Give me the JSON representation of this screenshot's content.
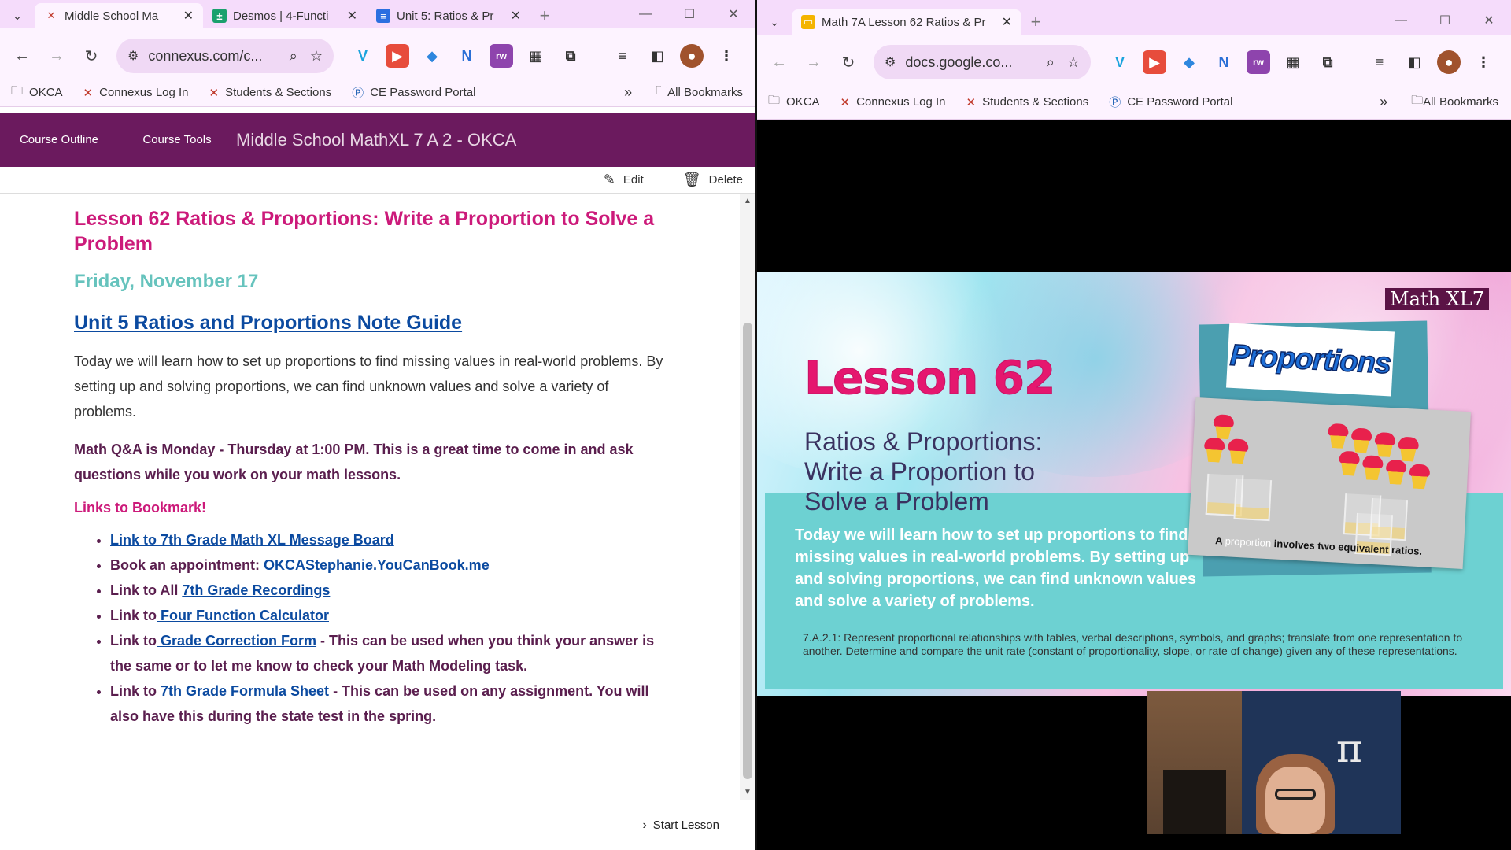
{
  "left_window": {
    "tabs": [
      {
        "title": "Middle School Ma",
        "favicon": "connexus-x-icon",
        "active": true
      },
      {
        "title": "Desmos | 4-Functi",
        "favicon": "desmos-icon",
        "active": false
      },
      {
        "title": "Unit 5: Ratios & Pr",
        "favicon": "docs-icon",
        "active": false
      }
    ],
    "url": "connexus.com/c...",
    "bookmarks": [
      "OKCA",
      "Connexus Log In",
      "Students & Sections",
      "CE Password Portal"
    ],
    "all_bookmarks": "All Bookmarks",
    "course_nav": {
      "outline": "Course Outline",
      "tools": "Course Tools",
      "title": "Middle School MathXL 7 A 2 - OKCA"
    },
    "edit_label": "Edit",
    "delete_label": "Delete",
    "lesson": {
      "heading": "Lesson 62 Ratios & Proportions: Write a Proportion to Solve a Problem",
      "date": "Friday, November 17",
      "guide_link": "Unit 5 Ratios and Proportions Note Guide",
      "intro": "Today we will learn how to set up proportions to find missing values in real-world problems. By setting up and solving proportions, we can find unknown values and solve a variety of problems.",
      "qa": "Math Q&A is Monday - Thursday at 1:00 PM. This is a great time to come in and ask questions while you work on your math lessons.",
      "links_heading": "Links to Bookmark!",
      "links": [
        {
          "prefix": "",
          "link": "Link to 7th Grade Math XL Message Board",
          "suffix": ""
        },
        {
          "prefix": "Book an appointment:",
          "link": " OKCAStephanie.YouCanBook.me",
          "suffix": ""
        },
        {
          "prefix": "Link to All ",
          "link": "7th Grade Recordings",
          "suffix": ""
        },
        {
          "prefix": "Link to",
          "link": " Four Function Calculator",
          "suffix": ""
        },
        {
          "prefix": "Link to",
          "link": " Grade Correction Form",
          "suffix": " - This can be used when you think your answer is the same or to let me know to check your Math Modeling task."
        },
        {
          "prefix": "Link to ",
          "link": "7th Grade Formula Sheet",
          "suffix": " - This can be used on any assignment. You will also have this during the state test in the spring."
        }
      ]
    },
    "start_lesson": "Start Lesson"
  },
  "right_window": {
    "tab_title": "Math 7A Lesson 62 Ratios & Pr",
    "url": "docs.google.co...",
    "bookmarks": [
      "OKCA",
      "Connexus Log In",
      "Students & Sections",
      "CE Password Portal"
    ],
    "all_bookmarks": "All Bookmarks",
    "slide": {
      "badge": "Math XL7",
      "lesson": "Lesson 62",
      "subtitle_lines": [
        "Ratios & Proportions:",
        "Write a Proportion to",
        "Solve a Problem"
      ],
      "paragraph": "Today we will learn how to set up proportions to find missing values in real-world problems. By setting up and solving proportions, we can find unknown values and solve a variety of problems.",
      "standard": "7.A.2.1: Represent proportional relationships with tables, verbal descriptions, symbols, and graphs; translate from one representation to another. Determine and compare the unit rate (constant of proportionality, slope, or rate of change) given any of these representations.",
      "image_logo": "Proportions",
      "image_caption_a": "A",
      "image_caption_word": "proportion",
      "image_caption_rest": "involves two equivalent ratios."
    }
  },
  "colors": {
    "tabstrip": "#f5dcfb",
    "course_bar": "#6b1a5e",
    "heading_pink": "#cc1a7a",
    "date_teal": "#66c3bd",
    "link_blue": "#0b4aa0",
    "body_purple": "#5a1e4e"
  }
}
